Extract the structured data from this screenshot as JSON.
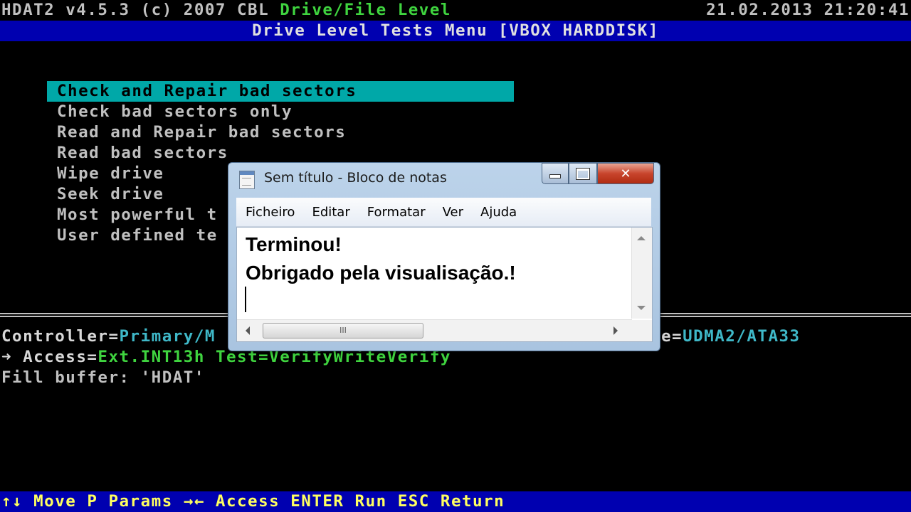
{
  "header": {
    "app_title": "HDAT2 v4.5.3 (c) 2007 CBL",
    "level": "Drive/File Level",
    "datetime": "21.02.2013 21:20:41"
  },
  "menu_title": "Drive Level Tests Menu [VBOX HARDDISK]",
  "menu_items": [
    "Check and Repair bad sectors",
    "Check bad sectors only",
    "Read and Repair bad sectors",
    "Read bad sectors",
    "Wipe drive",
    "Seek drive",
    "Most powerful t",
    "User defined te"
  ],
  "status": {
    "controller_label": "Controller=",
    "controller_value": "Primary/M",
    "mode_suffix": "e=",
    "mode_value": "UDMA2/ATA33",
    "arrow": "➜",
    "access_label": "Access=",
    "access_value": "Ext.INT13h",
    "test_partial": "Test=VerifyWriteVerify",
    "fill_buffer": "Fill buffer: 'HDAT'"
  },
  "bottombar": {
    "text": "↑↓ Move P Params →← Access ENTER Run ESC Return"
  },
  "notepad": {
    "title": "Sem título - Bloco de notas",
    "close_symbol": "✕",
    "menu": [
      "Ficheiro",
      "Editar",
      "Formatar",
      "Ver",
      "Ajuda"
    ],
    "lines": [
      "Terminou!",
      "Obrigado pela visualisação.!"
    ],
    "scroll_thumb": "III"
  }
}
